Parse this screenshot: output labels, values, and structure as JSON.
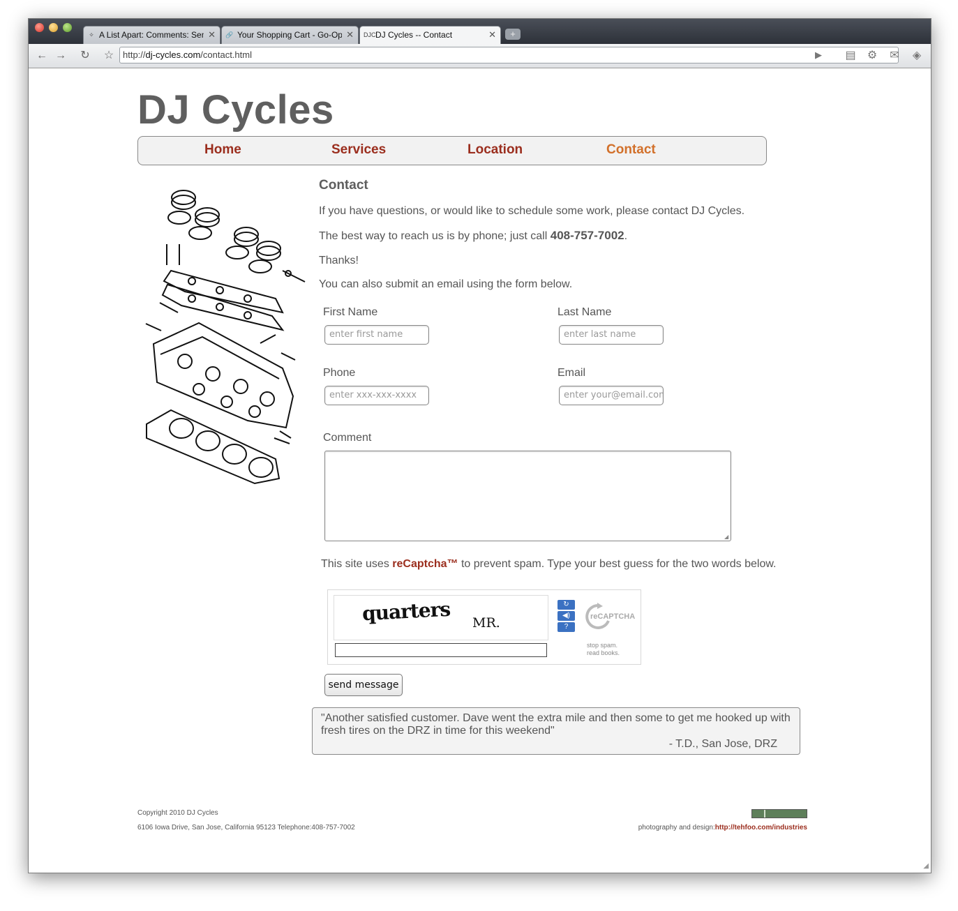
{
  "browser": {
    "tabs": [
      {
        "favicon": "star-icon",
        "label": "A List Apart: Comments: Sen",
        "active": false
      },
      {
        "favicon": "link-icon",
        "label": "Your Shopping Cart - Go-Op",
        "active": false
      },
      {
        "favicon": "DJC",
        "label": "DJ Cycles -- Contact",
        "active": true
      }
    ],
    "new_tab_icon": "plus-icon",
    "url_prefix": "http://",
    "url_host": "dj-cycles.com",
    "url_path": "/contact.html"
  },
  "site": {
    "title": "DJ Cycles",
    "nav": [
      {
        "label": "Home",
        "current": false
      },
      {
        "label": "Services",
        "current": false
      },
      {
        "label": "Location",
        "current": false
      },
      {
        "label": "Contact",
        "current": true
      }
    ]
  },
  "content": {
    "heading": "Contact",
    "intro": "If you have questions, or would like to schedule some work, please contact DJ Cycles.",
    "phone_pre": "The best way to reach us is by phone; just call ",
    "phone": "408-757-7002",
    "phone_post": ".",
    "thanks": "Thanks!",
    "form_intro": "You can also submit an email using the form below."
  },
  "form": {
    "first_name_label": "First Name",
    "first_name_placeholder": "enter first name",
    "last_name_label": "Last Name",
    "last_name_placeholder": "enter last name",
    "phone_label": "Phone",
    "phone_placeholder": "enter xxx-xxx-xxxx",
    "email_label": "Email",
    "email_placeholder": "enter your@email.com",
    "comment_label": "Comment",
    "submit_label": "send message"
  },
  "captcha": {
    "note_pre": "This site uses ",
    "note_link": "reCaptcha™",
    "note_post": " to prevent spam. Type your best guess for the two words below.",
    "word1": "quarters",
    "word2": "MR.",
    "logo_text": "reCAPTCHA™",
    "tagline_1": "stop spam.",
    "tagline_2": "read books.",
    "buttons": [
      "refresh-icon",
      "audio-icon",
      "help-icon"
    ]
  },
  "testimonial": {
    "quote": "\"Another satisfied customer. Dave went the extra mile and then some to get me hooked up with fresh tires on the DRZ in time for this weekend\"",
    "attribution": "- T.D., San Jose, DRZ"
  },
  "footer": {
    "copyright": "Copyright 2010 DJ Cycles",
    "address": "6106 Iowa Drive, San Jose, California 95123 Telephone:408-757-7002",
    "credit_pre": "photography and design:",
    "credit_link": "http://tehfoo.com/industries"
  }
}
